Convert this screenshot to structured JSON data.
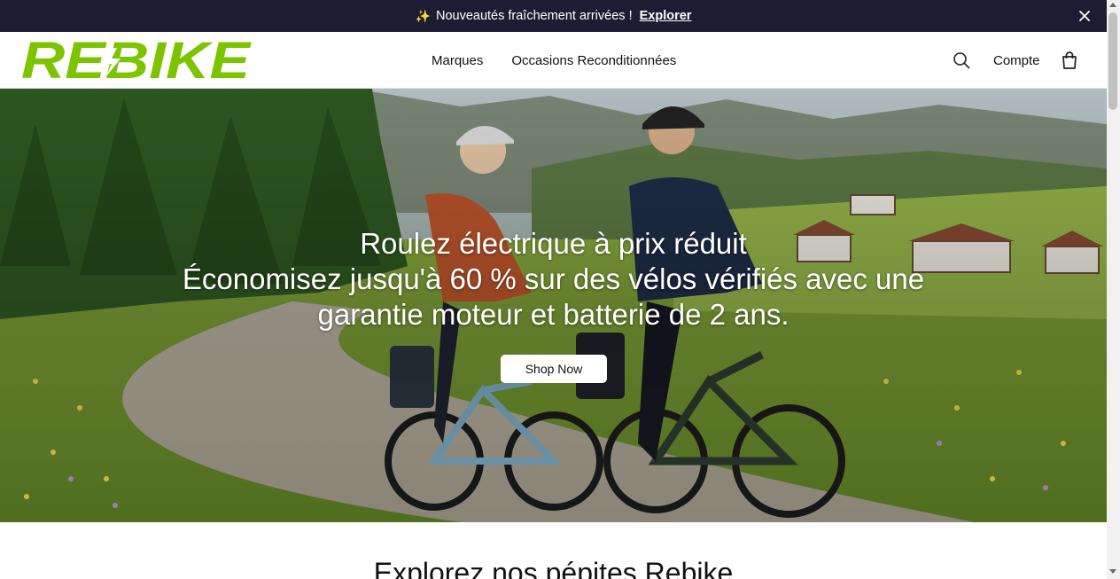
{
  "announcement": {
    "sparkle": "✨",
    "text": "Nouveautés fraîchement arrivées !",
    "link": "Explorer"
  },
  "header": {
    "logo_text": "REBIKE",
    "nav": [
      "Marques",
      "Occasions Reconditionnées"
    ],
    "account": "Compte"
  },
  "hero": {
    "line1": "Roulez électrique à prix réduit",
    "line2": "Économisez jusqu'à 60 % sur des vélos vérifiés avec une",
    "line3": "garantie moteur et batterie de 2 ans.",
    "cta": "Shop Now"
  },
  "section": {
    "title": "Explorez nos pépites Rebike"
  },
  "colors": {
    "announce_bg": "#1c1d33",
    "brand_green": "#7dc400"
  }
}
